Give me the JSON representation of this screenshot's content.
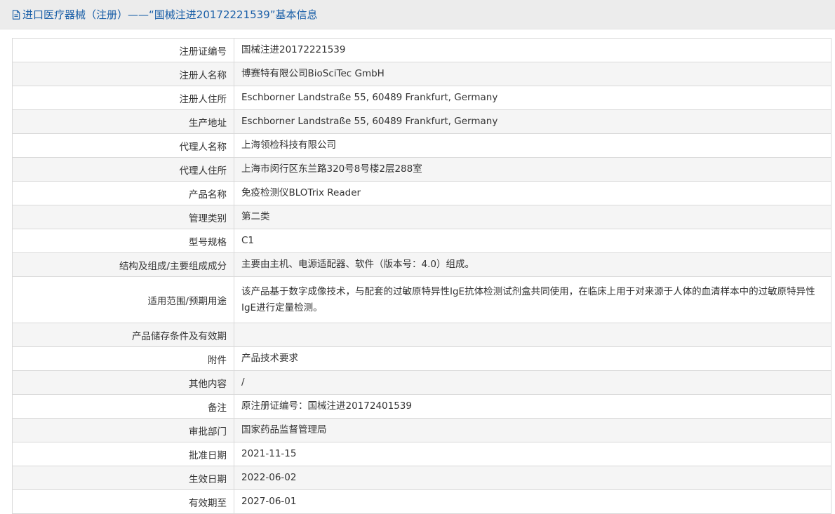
{
  "header": {
    "icon": "document-icon",
    "title": "进口医疗器械（注册）——“国械注进20172221539”基本信息"
  },
  "colors": {
    "title_blue": "#1a5fa8",
    "header_bg": "#ececec",
    "row_alt_bg": "#f5f5f5",
    "border": "#d9d9d9"
  },
  "rows": [
    {
      "label": "注册证编号",
      "value": "国械注进20172221539"
    },
    {
      "label": "注册人名称",
      "value": "博赛特有限公司BioSciTec GmbH"
    },
    {
      "label": "注册人住所",
      "value": "Eschborner Landstraße 55, 60489 Frankfurt, Germany"
    },
    {
      "label": "生产地址",
      "value": "Eschborner Landstraße 55, 60489 Frankfurt, Germany"
    },
    {
      "label": "代理人名称",
      "value": "上海领检科技有限公司"
    },
    {
      "label": "代理人住所",
      "value": "上海市闵行区东兰路320号8号楼2层288室"
    },
    {
      "label": "产品名称",
      "value": "免疫检测仪BLOTrix Reader"
    },
    {
      "label": "管理类别",
      "value": "第二类"
    },
    {
      "label": "型号规格",
      "value": "C1"
    },
    {
      "label": "结构及组成/主要组成成分",
      "value": "主要由主机、电源适配器、软件（版本号：4.0）组成。"
    },
    {
      "label": "适用范围/预期用途",
      "value": "该产品基于数字成像技术，与配套的过敏原特异性IgE抗体检测试剂盒共同使用，在临床上用于对来源于人体的血清样本中的过敏原特异性IgE进行定量检测。"
    },
    {
      "label": "产品储存条件及有效期",
      "value": ""
    },
    {
      "label": "附件",
      "value": "产品技术要求"
    },
    {
      "label": "其他内容",
      "value": "/"
    },
    {
      "label": "备注",
      "value": "原注册证编号：国械注进20172401539"
    },
    {
      "label": "审批部门",
      "value": "国家药品监督管理局"
    },
    {
      "label": "批准日期",
      "value": "2021-11-15"
    },
    {
      "label": "生效日期",
      "value": "2022-06-02"
    },
    {
      "label": "有效期至",
      "value": "2027-06-01"
    }
  ]
}
